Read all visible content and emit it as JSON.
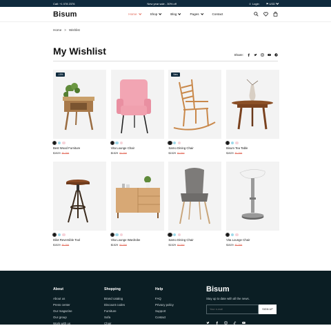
{
  "topbar": {
    "call": "Call: +1 078 2376",
    "promo": "New year sale - 30% off",
    "login": "Login",
    "currency": "USD"
  },
  "header": {
    "logo": "Bisum",
    "nav": [
      "Home",
      "Shop",
      "Blog",
      "Pages",
      "Contact"
    ]
  },
  "breadcrumb": {
    "home": "Home",
    "sep": ">",
    "current": "Wishlist"
  },
  "page": {
    "title": "My Wishlist",
    "share_label": "Share:"
  },
  "products": [
    {
      "name": "Best Wood Furniture",
      "price": "$1529",
      "old": "$1759",
      "badge": "-10%"
    },
    {
      "name": "Vita Lounge Chair",
      "price": "$1529",
      "old": "$1759",
      "badge": ""
    },
    {
      "name": "Sarno Dining Chair",
      "price": "$1529",
      "old": "$1759",
      "badge": "New"
    },
    {
      "name": "Bisum Tea Table",
      "price": "$1529",
      "old": "$1759",
      "badge": ""
    },
    {
      "name": "Dilot Reversible Tool",
      "price": "$1529",
      "old": "$1759",
      "badge": ""
    },
    {
      "name": "Vita Lounge Wardrobe",
      "price": "$1529",
      "old": "$1759",
      "badge": ""
    },
    {
      "name": "Sarno Dining Chair",
      "price": "$1529",
      "old": "$1759",
      "badge": ""
    },
    {
      "name": "Vita Lounge Chair",
      "price": "$1529",
      "old": "$1759",
      "badge": ""
    }
  ],
  "swatch_colors": [
    "#111111",
    "#9fd9ea",
    "#f6d3d9"
  ],
  "footer": {
    "about": {
      "title": "About",
      "links": [
        "About us",
        "Press center",
        "Our magazine",
        "Our group",
        "Work with us"
      ]
    },
    "shopping": {
      "title": "Shopping",
      "links": [
        "Brand catalog",
        "Discount codes",
        "Furniture",
        "Sofa",
        "Chair"
      ]
    },
    "help": {
      "title": "Help",
      "links": [
        "FAQ",
        "Privacy policy",
        "Support",
        "Contact"
      ]
    },
    "brand": "Bisum",
    "tagline": "Stay up to date with all the news.",
    "email_placeholder": "Your e-mail",
    "signup": "SIGN UP"
  }
}
